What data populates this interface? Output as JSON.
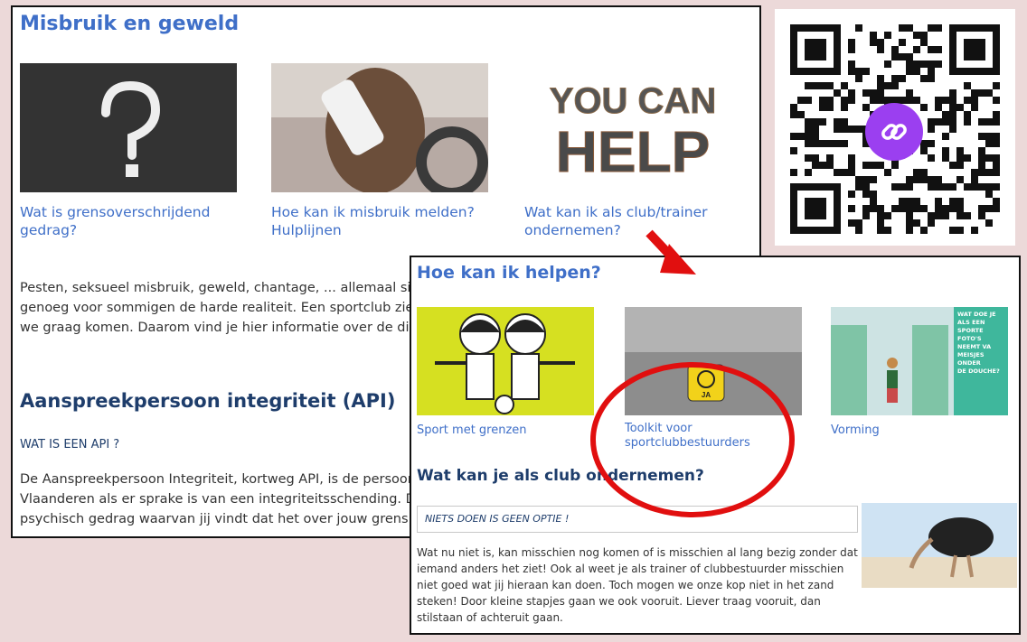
{
  "panel1": {
    "title": "Misbruik en geweld",
    "cards": [
      {
        "label": "Wat is grensoverschrijdend gedrag?",
        "image_icon": "question-mark-icon"
      },
      {
        "label": "Hoe kan ik misbruik melden? Hulplijnen",
        "image_icon": "phone-driver-image"
      },
      {
        "label": "Wat kan ik als club/trainer ondernemen?",
        "image_icon": "you-can-help-image"
      }
    ],
    "intro_lines": [
      "Pesten, seksueel misbruik, geweld, chantage, ... allemaal situa",
      "genoeg voor sommigen de harde realiteit. Een sportclub zien",
      "we graag komen. Daarom vind je hier informatie over de divers"
    ],
    "section_title": "Aanspreekpersoon integriteit (API)",
    "subheading": "WAT IS EEN API ?",
    "api_lines": [
      "De Aanspreekpersoon Integriteit, kortweg API, is de persoon c",
      "Vlaanderen als er sprake is van een integriteitsschending. Dat",
      "psychisch gedrag waarvan jij vindt dat het over jouw grens ga"
    ]
  },
  "panel2": {
    "title": "Hoe kan ik helpen?",
    "cards": [
      {
        "label": "Sport met grenzen"
      },
      {
        "label": "Toolkit voor sportclubbestuurders",
        "dice_text": "JA"
      },
      {
        "label": "Vorming",
        "sidebar_lines": [
          "WAT DOE JE",
          "ALS EEN SPORTE",
          "FOTO'S NEEMT VA",
          "MEISJES ONDER",
          "DE DOUCHE?"
        ]
      }
    ],
    "section_title": "Wat kan je als club ondernemen?",
    "callout": "NIETS DOEN IS GEEN OPTIE !",
    "paragraph_lines": [
      "Wat nu niet is, kan misschien nog komen of is misschien al lang bezig zonder dat",
      "iemand anders het ziet! Ook al weet je als trainer of clubbestuurder misschien",
      "niet goed wat jij hieraan kan doen. Toch mogen we onze kop niet in het zand",
      "steken! Door kleine stapjes gaan we ook vooruit. Liever traag vooruit, dan",
      "stilstaan of achteruit gaan."
    ]
  },
  "qr": {
    "icon": "link-icon"
  },
  "colors": {
    "link_blue": "#3f6fc8",
    "dark_blue": "#1e3d6b",
    "annotation_red": "#e10f0f",
    "qr_badge": "#9b3ff0",
    "background": "#ecd9d9"
  }
}
